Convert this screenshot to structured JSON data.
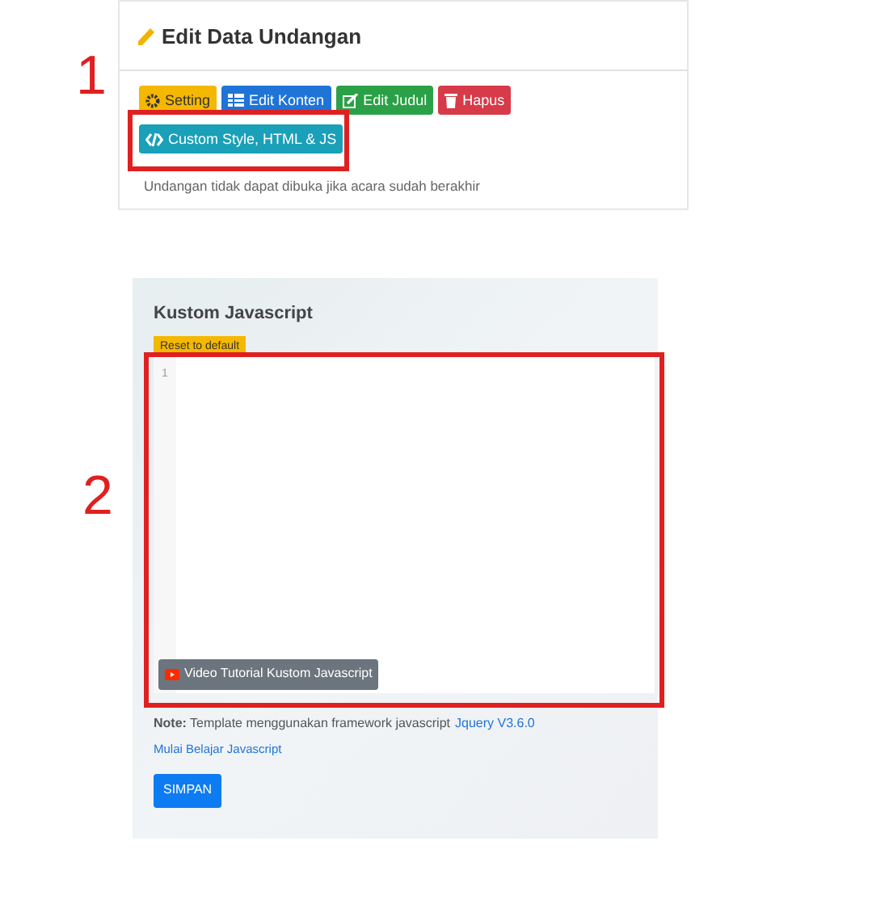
{
  "edit_card": {
    "title": "Edit Data Undangan",
    "buttons": [
      {
        "label": "Setting",
        "kind": "warning"
      },
      {
        "label": "Edit Konten",
        "kind": "primary"
      },
      {
        "label": "Edit Judul",
        "kind": "success"
      },
      {
        "label": "Hapus",
        "kind": "danger"
      },
      {
        "label": "Custom Style, HTML & JS",
        "kind": "info"
      }
    ],
    "note": "Undangan tidak dapat dibuka jika acara sudah berakhir"
  },
  "js_panel": {
    "title": "Kustom Javascript",
    "reset_button": "Reset to default",
    "line_numbers": [
      "1"
    ],
    "video_button": "Video Tutorial Kustom Javascript",
    "note": "**Note:** Template menggunakan framework javascript",
    "note_link": "Jquery V3.6.0",
    "learn_link": "Mulai Belajar Javascript",
    "save_button": "SIMPAN"
  },
  "annotations": [
    {
      "label": "1"
    },
    {
      "label": "2"
    }
  ]
}
